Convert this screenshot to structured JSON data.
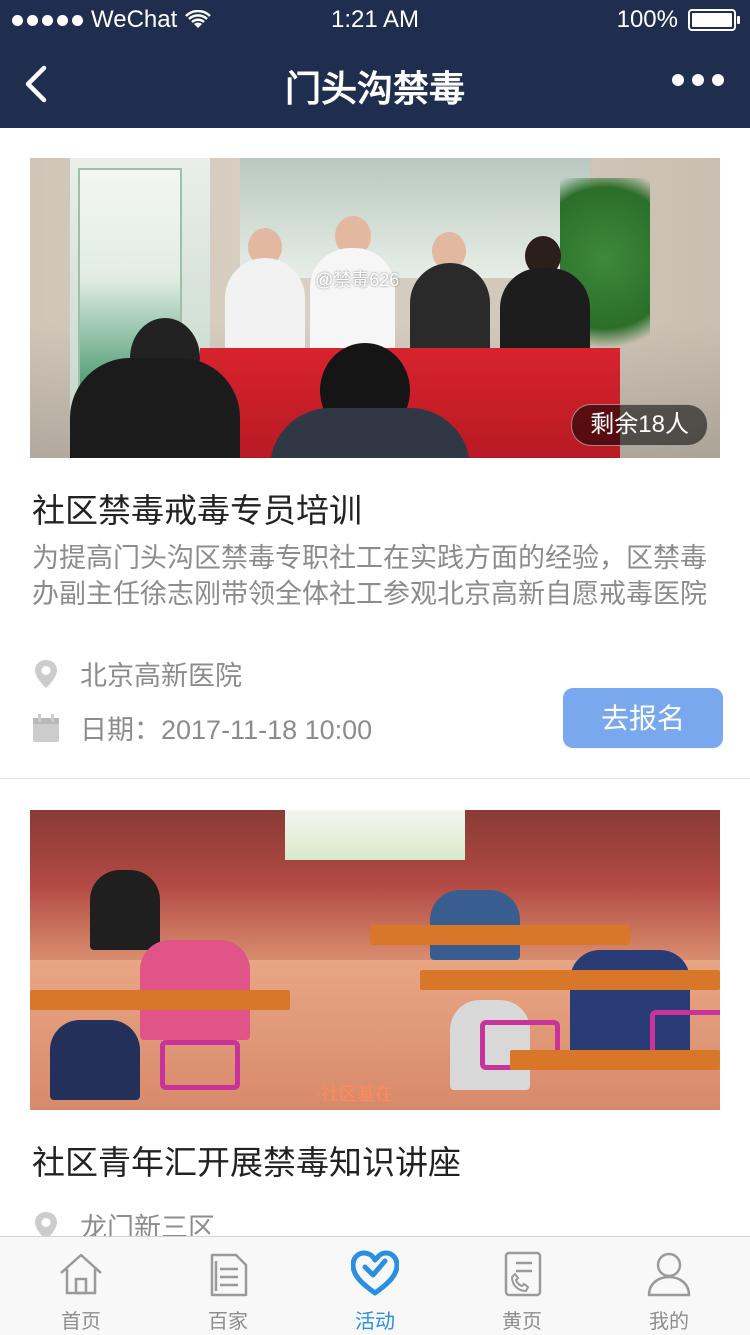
{
  "status_bar": {
    "carrier": "WeChat",
    "time": "1:21 AM",
    "battery": "100%"
  },
  "nav": {
    "title": "门头沟禁毒",
    "back_icon": "chevron-left-icon",
    "more_icon": "more-dots-icon"
  },
  "activities": [
    {
      "image_watermark": "@禁毒626",
      "remaining": "剩余18人",
      "title": "社区禁毒戒毒专员培训",
      "description": "为提高门头沟区禁毒专职社工在实践方面的经验，区禁毒办副主任徐志刚带领全体社工参观北京高新自愿戒毒医院",
      "location": "北京高新医院",
      "date": "日期：2017-11-18 10:00",
      "signup_label": "去报名"
    },
    {
      "image_floor_text": "·社区基在",
      "title": "社区青年汇开展禁毒知识讲座",
      "location": "龙门新三区"
    }
  ],
  "tabbar": [
    {
      "label": "首页",
      "icon": "home-icon",
      "active": false
    },
    {
      "label": "百家",
      "icon": "document-icon",
      "active": false
    },
    {
      "label": "活动",
      "icon": "heart-hands-icon",
      "active": true
    },
    {
      "label": "黄页",
      "icon": "phone-book-icon",
      "active": false
    },
    {
      "label": "我的",
      "icon": "user-icon",
      "active": false
    }
  ],
  "colors": {
    "header_bg": "#1f2d4e",
    "signup_bg": "#7aa8ef",
    "tab_active": "#2a8fe0",
    "tab_inactive": "#8e8e8e"
  }
}
